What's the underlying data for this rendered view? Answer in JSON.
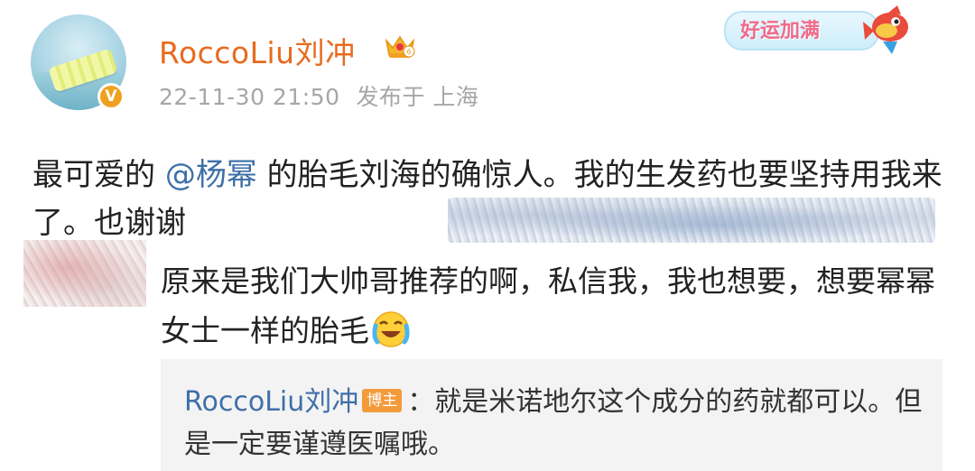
{
  "author": {
    "username": "RoccoLiu刘冲",
    "verified_badge": "V",
    "avatar_icon": "pool-float-avatar",
    "crown_icon": "crown-level-6-icon"
  },
  "meta": {
    "timestamp": "22-11-30 21:50",
    "location": "发布于 上海"
  },
  "decor_badge": {
    "text": "好运加满",
    "icon": "lucky-fish-icon"
  },
  "post": {
    "text_before": "最可爱的 ",
    "mention": "@杨幂",
    "text_after": " 的胎毛刘海的确惊人。我的生发药也要坚持用我来了。也谢谢"
  },
  "comment": {
    "text": "原来是我们大帅哥推荐的啊，私信我，我也想要，想要幂幂女士一样的胎毛",
    "emoji": "crying-laugh-emoji"
  },
  "reply": {
    "name": "RoccoLiu刘冲",
    "tag": "博主",
    "text": "：就是米诺地尔这个成分的药就都可以。但是一定要谨遵医嘱哦。"
  },
  "colors": {
    "username": "#e86a1f",
    "mention": "#3e6fa8",
    "meta": "#a6a6a6",
    "reply_bg": "#f3f3f3",
    "tag_bg": "#f39a3a"
  }
}
